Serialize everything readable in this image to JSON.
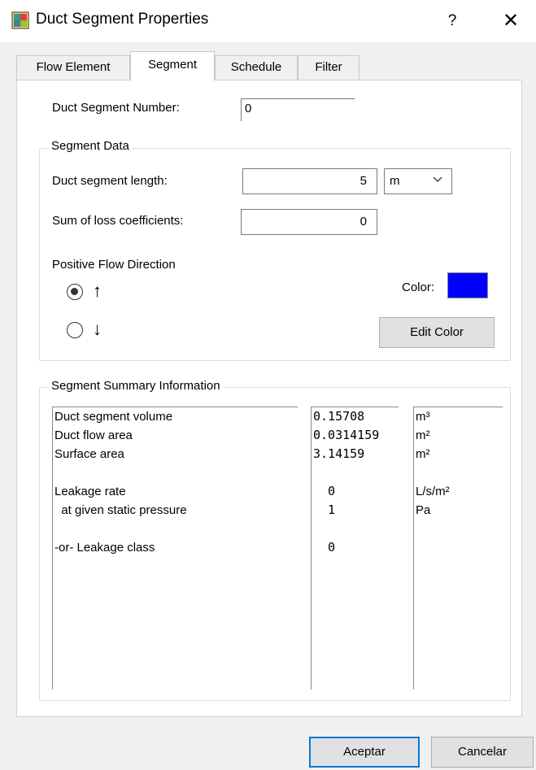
{
  "window": {
    "title": "Duct Segment Properties",
    "help": "?",
    "close": "✕"
  },
  "tabs": [
    {
      "label": "Flow Element",
      "active": false
    },
    {
      "label": "Segment",
      "active": true
    },
    {
      "label": "Schedule",
      "active": false
    },
    {
      "label": "Filter",
      "active": false
    }
  ],
  "segment": {
    "number_label": "Duct Segment Number:",
    "number_value": "0",
    "data_group_title": "Segment Data",
    "length_label": "Duct segment length:",
    "length_value": "5",
    "length_unit": "m",
    "loss_label": "Sum of loss coefficients:",
    "loss_value": "0",
    "flow_direction_label": "Positive Flow Direction",
    "direction_options": [
      {
        "symbol": "↑",
        "selected": true
      },
      {
        "symbol": "↓",
        "selected": false
      }
    ],
    "color_label": "Color:",
    "color_value": "#0000ff",
    "edit_color_label": "Edit Color"
  },
  "summary": {
    "title": "Segment Summary Information",
    "names": [
      "Duct segment volume",
      "Duct flow area",
      "Surface area",
      "",
      "Leakage rate",
      "  at given static pressure",
      "",
      "-or- Leakage class"
    ],
    "values": [
      "0.15708",
      "0.0314159",
      "3.14159",
      "",
      "  0",
      "  1",
      "",
      "  0"
    ],
    "units": [
      "m³",
      "m²",
      "m²",
      "",
      "L/s/m²",
      "Pa",
      "",
      ""
    ]
  },
  "footer": {
    "ok_label": "Aceptar",
    "cancel_label": "Cancelar"
  },
  "colors": {
    "accent": "#0078d7",
    "swatch": "#0000ff"
  }
}
